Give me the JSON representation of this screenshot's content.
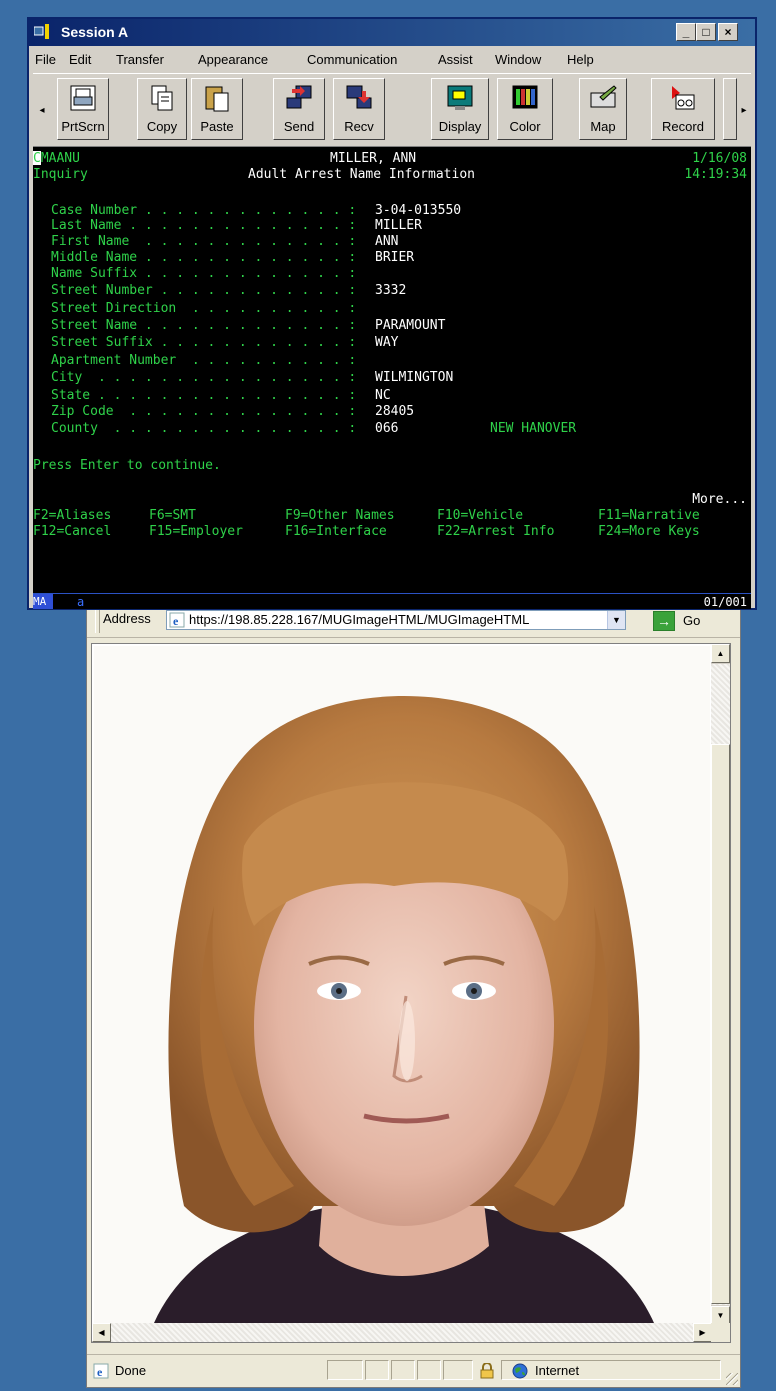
{
  "session": {
    "title": "Session A",
    "min_icon": "_",
    "max_icon": "□",
    "close_icon": "×",
    "menu": [
      "File",
      "Edit",
      "Transfer",
      "Appearance",
      "Communication",
      "Assist",
      "Window",
      "Help"
    ],
    "toolbar": [
      {
        "label": "PrtScrn",
        "icon": "printer-icon"
      },
      {
        "label": "Copy",
        "icon": "copy-icon"
      },
      {
        "label": "Paste",
        "icon": "paste-icon"
      },
      {
        "label": "Send",
        "icon": "send-icon"
      },
      {
        "label": "Recv",
        "icon": "receive-icon"
      },
      {
        "label": "Display",
        "icon": "display-icon"
      },
      {
        "label": "Color",
        "icon": "color-icon"
      },
      {
        "label": "Map",
        "icon": "map-icon"
      },
      {
        "label": "Record",
        "icon": "record-icon"
      }
    ],
    "scroll_left": "◂",
    "scroll_right": "▸"
  },
  "terminal": {
    "program": "CMAANU",
    "mode": "Inquiry",
    "subject_name": "MILLER, ANN",
    "screen_title": "Adult Arrest Name Information",
    "date": "1/16/08",
    "time": "14:19:34",
    "fields": [
      {
        "label": "Case Number . . . . . . . . . . . . . :",
        "value": "3-04-013550"
      },
      {
        "label": "Last Name . . . . . . . . . . . . . . :",
        "value": "MILLER"
      },
      {
        "label": "First Name  . . . . . . . . . . . . . :",
        "value": "ANN"
      },
      {
        "label": "Middle Name . . . . . . . . . . . . . :",
        "value": "BRIER"
      },
      {
        "label": "Name Suffix . . . . . . . . . . . . . :",
        "value": ""
      },
      {
        "label": "Street Number . . . . . . . . . . . . :",
        "value": "3332"
      },
      {
        "label": "Street Direction  . . . . . . . . . . :",
        "value": ""
      },
      {
        "label": "Street Name . . . . . . . . . . . . . :",
        "value": "PARAMOUNT"
      },
      {
        "label": "Street Suffix . . . . . . . . . . . . :",
        "value": "WAY"
      },
      {
        "label": "Apartment Number  . . . . . . . . . . :",
        "value": ""
      },
      {
        "label": "City  . . . . . . . . . . . . . . . . :",
        "value": "WILMINGTON"
      },
      {
        "label": "State . . . . . . . . . . . . . . . . :",
        "value": "NC"
      },
      {
        "label": "Zip Code  . . . . . . . . . . . . . . :",
        "value": "28405"
      },
      {
        "label": "County  . . . . . . . . . . . . . . . :",
        "value": "066"
      }
    ],
    "county_name": "NEW HANOVER",
    "prompt": "Press Enter to continue.",
    "more": "More...",
    "fkeys_row1": [
      "F2=Aliases",
      "F6=SMT",
      "F9=Other Names",
      "F10=Vehicle",
      "F11=Narrative"
    ],
    "fkeys_row2": [
      "F12=Cancel",
      "F15=Employer",
      "F16=Interface",
      "F22=Arrest Info",
      "F24=More Keys"
    ],
    "status_ma": "MA",
    "status_a": "a",
    "status_page": "01/001"
  },
  "browser": {
    "address_label": "Address",
    "url": "https://198.85.228.167/MUGImageHTML/MUGImageHTML",
    "go_label": "Go",
    "status_text": "Done",
    "zone": "Internet"
  },
  "colors": {
    "terminal_green": "#2fd24a",
    "terminal_bg": "#000000",
    "desktop": "#3a6ea5",
    "title_bar": "#0a246a"
  }
}
